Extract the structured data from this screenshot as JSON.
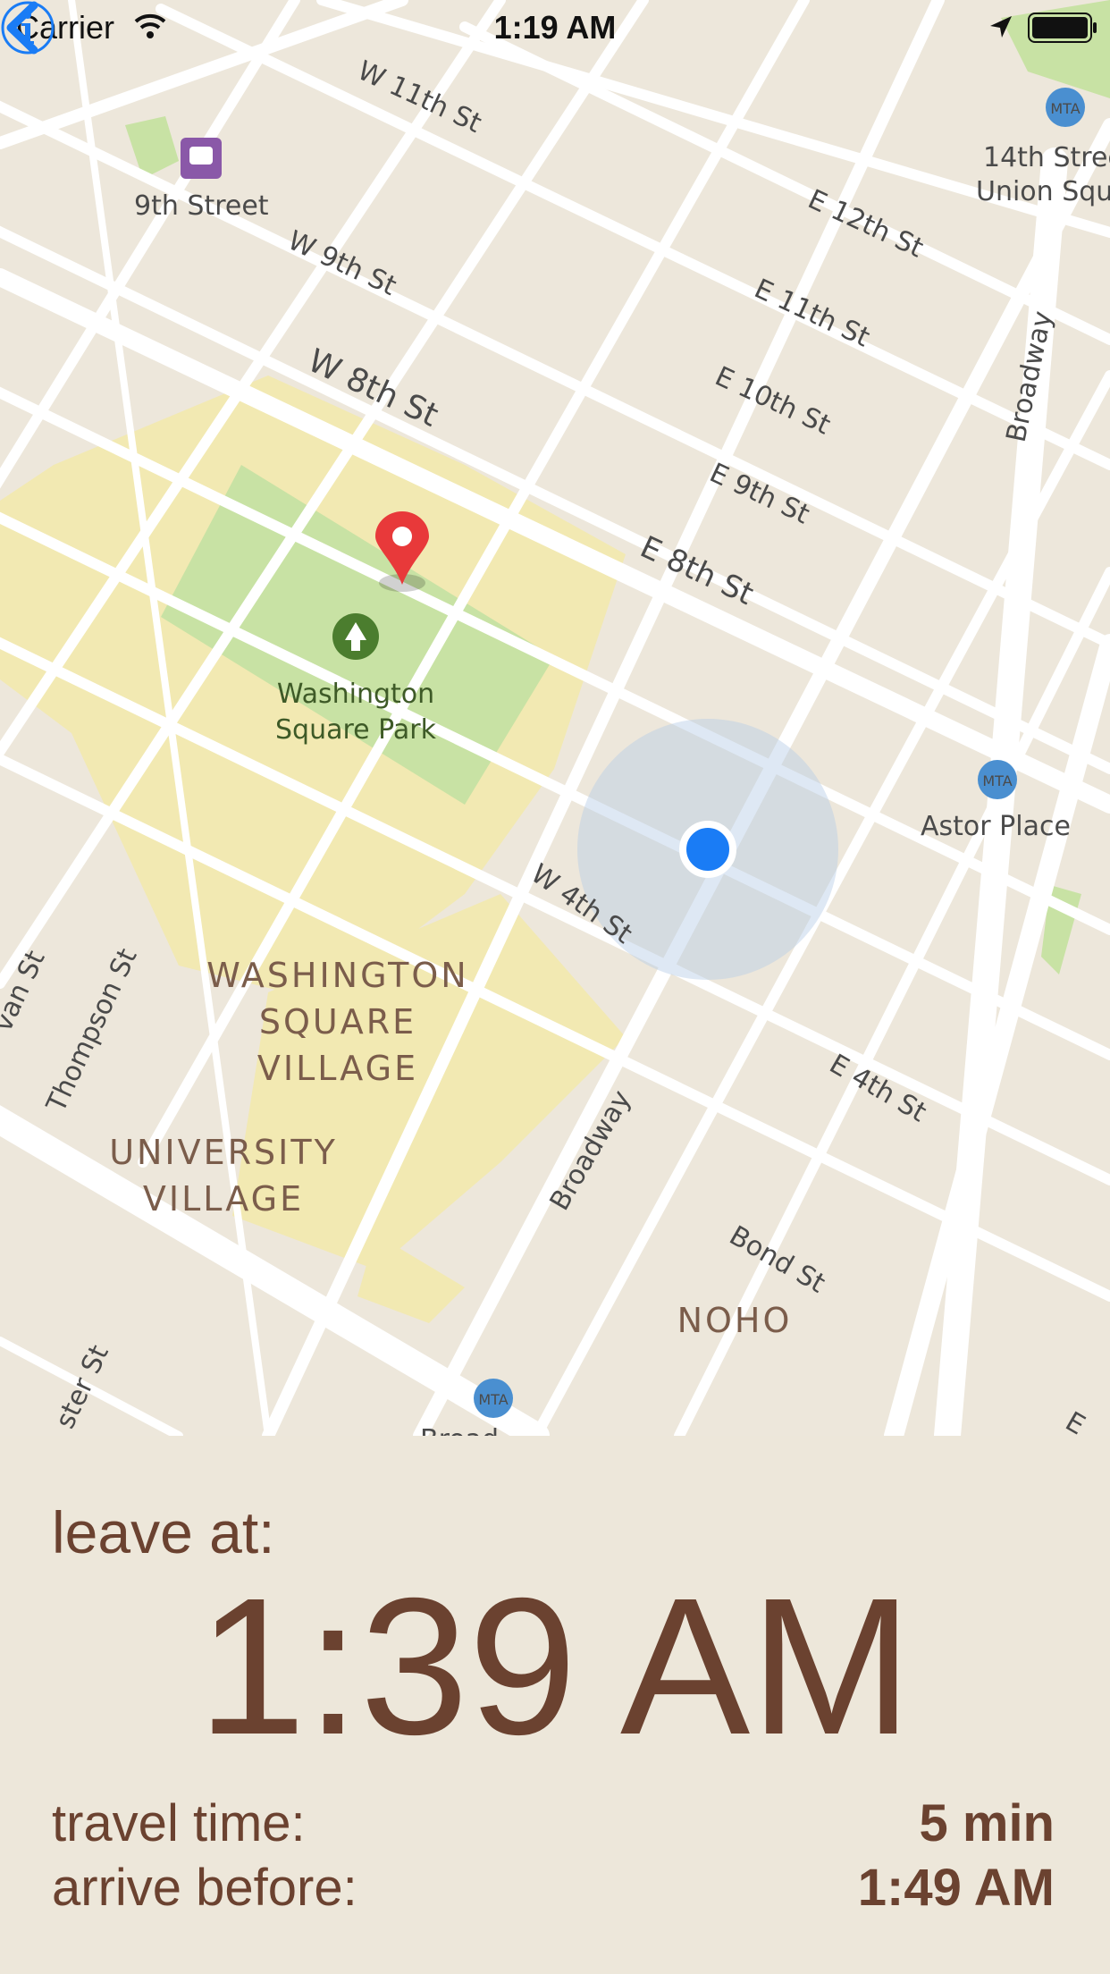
{
  "status_bar": {
    "carrier": "Carrier",
    "time": "1:19 AM"
  },
  "map": {
    "labels": {
      "w11": "W 11th St",
      "w9": "W 9th St",
      "w8": "W 8th St",
      "e12": "E 12th St",
      "e11": "E 11th St",
      "e10": "E 10th St",
      "e9": "E 9th St",
      "e8": "E 8th St",
      "w4": "W 4th St",
      "e4": "E 4th St",
      "bond": "Bond St",
      "broadway_top": "Broadway",
      "broadway_bottom": "Broadway",
      "thompson": "Thompson St",
      "sullivan": "van St",
      "laguardia": "ster St",
      "ninth_street": "9th Street",
      "union_sq_1": "14th Stree",
      "union_sq_2": "Union Squ",
      "astor": "Astor Place",
      "wsp_1": "Washington",
      "wsp_2": "Square Park",
      "wsv_1": "WASHINGTON",
      "wsv_2": "SQUARE",
      "wsv_3": "VILLAGE",
      "uv_1": "UNIVERSITY",
      "uv_2": "VILLAGE",
      "noho": "NOHO",
      "metro": "MTA",
      "partial_bottom": "Broad",
      "partial_right": "E"
    },
    "colors": {
      "user_dot": "#1a7cf5",
      "pin": "#e8393a",
      "park": "#c8e2a4",
      "campus": "#f2e9b2"
    }
  },
  "panel": {
    "leave_label": "leave at:",
    "leave_time": "1:39 AM",
    "travel_label": "travel time:",
    "travel_value": "5 min",
    "arrive_label": "arrive before:",
    "arrive_value": "1:49 AM"
  },
  "icons": {
    "back": "chevron-left-icon",
    "info": "info-icon",
    "wifi": "wifi-icon",
    "location": "location-arrow-icon",
    "battery": "battery-icon"
  }
}
